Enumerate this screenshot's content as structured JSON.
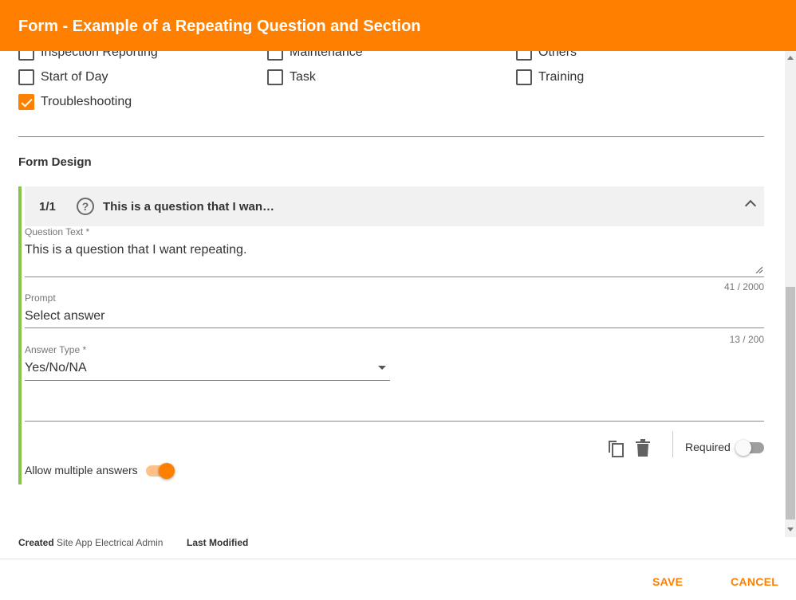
{
  "header": {
    "title": "Form - Example of a Repeating Question and Section"
  },
  "categories": [
    {
      "label": "Inspection Reporting",
      "checked": false
    },
    {
      "label": "Maintenance",
      "checked": false
    },
    {
      "label": "Others",
      "checked": false
    },
    {
      "label": "Start of Day",
      "checked": false
    },
    {
      "label": "Task",
      "checked": false
    },
    {
      "label": "Training",
      "checked": false
    },
    {
      "label": "Troubleshooting",
      "checked": true
    }
  ],
  "form_design": {
    "title": "Form Design",
    "question": {
      "number": "1/1",
      "header_title": "This is a question that I wan…",
      "help_icon": "help-circle-icon",
      "question_text_label": "Question Text *",
      "question_text_value": "This is a question that I want repeating.",
      "question_text_count": "41 / 2000",
      "prompt_label": "Prompt",
      "prompt_value": "Select answer",
      "prompt_count": "13 / 200",
      "answer_type_label": "Answer Type *",
      "answer_type_value": "Yes/No/NA",
      "required_label": "Required",
      "required_on": false,
      "allow_multiple_label": "Allow multiple answers",
      "allow_multiple_on": true
    }
  },
  "footer": {
    "created_label": "Created",
    "created_value": "Site App Electrical Admin",
    "modified_label": "Last Modified"
  },
  "actions": {
    "save": "SAVE",
    "cancel": "CANCEL"
  },
  "colors": {
    "accent": "#FF8000",
    "section_bar": "#8BC34A"
  }
}
